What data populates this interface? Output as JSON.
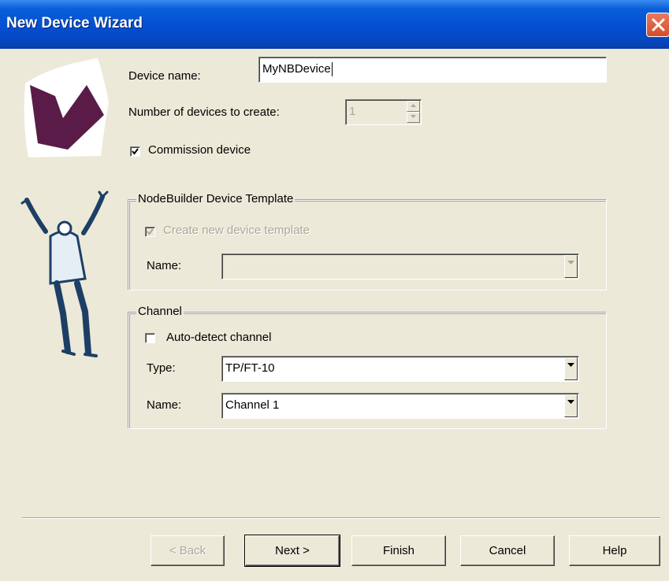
{
  "window": {
    "title": "New Device Wizard"
  },
  "form": {
    "device_name_label": "Device name:",
    "device_name_value": "MyNBDevice",
    "num_devices_label": "Number of devices to create:",
    "num_devices_value": "1",
    "commission_label": "Commission device",
    "commission_checked": true
  },
  "template_group": {
    "title": "NodeBuilder Device Template",
    "create_label": "Create new device template",
    "create_checked": true,
    "name_label": "Name:",
    "name_value": ""
  },
  "channel_group": {
    "title": "Channel",
    "auto_detect_label": "Auto-detect channel",
    "auto_detect_checked": false,
    "type_label": "Type:",
    "type_value": "TP/FT-10",
    "name_label": "Name:",
    "name_value": "Channel 1"
  },
  "buttons": {
    "back": "< Back",
    "next": "Next >",
    "finish": "Finish",
    "cancel": "Cancel",
    "help": "Help"
  },
  "colors": {
    "titlebar": "#0550d3",
    "dialog": "#ece9d8",
    "logo": "#5a1b48",
    "figure": "#1d3f66"
  }
}
